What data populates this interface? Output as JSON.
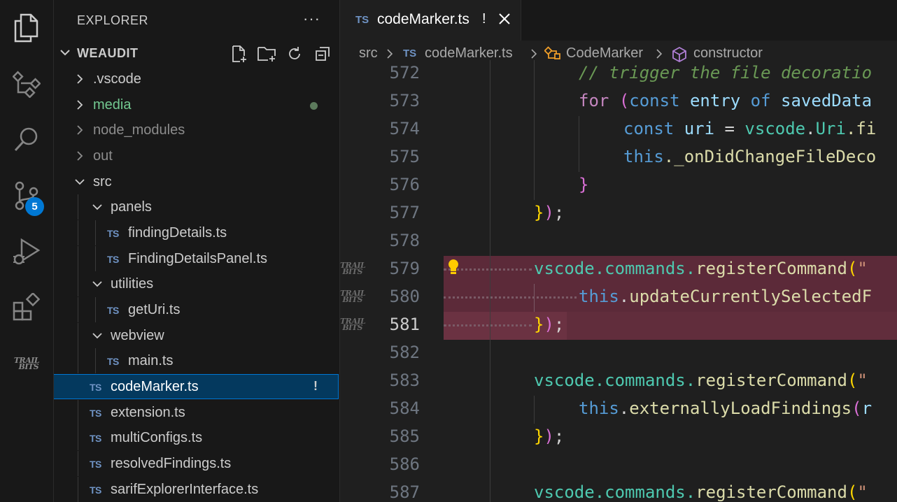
{
  "activity_bar": {
    "items": [
      "explorer-icon",
      "tree-icon",
      "search-icon",
      "source-control-icon",
      "run-debug-icon",
      "extensions-icon",
      "trailofbits-icon"
    ],
    "source_control_badge": "5",
    "trailofbits_logo_text": "TRAIL BITS"
  },
  "sidebar": {
    "title": "EXPLORER",
    "more": "···",
    "root": "WEAUDIT",
    "tree": [
      {
        "label": ".vscode",
        "type": "folder",
        "state": "collapsed"
      },
      {
        "label": "media",
        "type": "folder",
        "state": "collapsed",
        "status": "modified-dot"
      },
      {
        "label": "node_modules",
        "type": "folder",
        "state": "collapsed",
        "dim": true
      },
      {
        "label": "out",
        "type": "folder",
        "state": "collapsed",
        "dim": true
      },
      {
        "label": "src",
        "type": "folder",
        "state": "expanded"
      },
      {
        "label": "panels",
        "type": "folder",
        "state": "expanded"
      },
      {
        "label": "findingDetails.ts",
        "type": "file",
        "icon": "TS"
      },
      {
        "label": "FindingDetailsPanel.ts",
        "type": "file",
        "icon": "TS"
      },
      {
        "label": "utilities",
        "type": "folder",
        "state": "expanded"
      },
      {
        "label": "getUri.ts",
        "type": "file",
        "icon": "TS"
      },
      {
        "label": "webview",
        "type": "folder",
        "state": "expanded"
      },
      {
        "label": "main.ts",
        "type": "file",
        "icon": "TS"
      },
      {
        "label": "codeMarker.ts",
        "type": "file",
        "icon": "TS",
        "selected": true,
        "status": "!"
      },
      {
        "label": "extension.ts",
        "type": "file",
        "icon": "TS"
      },
      {
        "label": "multiConfigs.ts",
        "type": "file",
        "icon": "TS"
      },
      {
        "label": "resolvedFindings.ts",
        "type": "file",
        "icon": "TS"
      },
      {
        "label": "sarifExplorerInterface.ts",
        "type": "file",
        "icon": "TS"
      }
    ]
  },
  "editor": {
    "tab": {
      "icon": "TS",
      "name": "codeMarker.ts",
      "status": "!"
    },
    "breadcrumb": {
      "folder": "src",
      "file_icon": "TS",
      "file": "codeMarker.ts",
      "class": "CodeMarker",
      "member": "constructor"
    },
    "line_numbers": [
      "572",
      "573",
      "574",
      "575",
      "576",
      "577",
      "578",
      "579",
      "580",
      "581",
      "582",
      "583",
      "584",
      "585",
      "586",
      "587"
    ],
    "current_line": "581",
    "code": {
      "l572": "// trigger the file decoratio",
      "l573_for": "for",
      "l573_paren": "(",
      "l573_const": "const",
      "l573_entry": "entry",
      "l573_of": "of",
      "l573_saved": "savedData",
      "l574_const": "const",
      "l574_uri": "uri",
      "l574_eq": "=",
      "l574_vscode": "vscode",
      "l574_dot": ".",
      "l574_Uri": "Uri",
      "l574_rest": ".fi",
      "l575_this": "this",
      "l575_rest": "._onDidChangeFileDeco",
      "l576": "}",
      "l577_brace": "}",
      "l577_paren": ")",
      "l577_semi": ";",
      "l579_vscode": "vscode",
      "l579_commands": ".commands.",
      "l579_fn": "registerCommand",
      "l579_paren": "(",
      "l579_str": "\"",
      "l580_this": "this",
      "l580_dot": ".",
      "l580_fn": "updateCurrentlySelectedF",
      "l581_brace": "}",
      "l581_paren": ")",
      "l581_semi": ";",
      "l583_vscode": "vscode",
      "l583_commands": ".commands.",
      "l583_fn": "registerCommand",
      "l583_paren": "(",
      "l583_str": "\"",
      "l584_this": "this",
      "l584_dot": ".",
      "l584_fn": "externallyLoadFindings",
      "l584_paren": "(",
      "l584_rest": "r",
      "l585_brace": "}",
      "l585_paren": ")",
      "l585_semi": ";",
      "l587_vscode": "vscode",
      "l587_commands": ".commands.",
      "l587_fn": "registerCommand",
      "l587_paren": "(",
      "l587_str": "\""
    }
  },
  "colors": {
    "highlight": "#5c2a39",
    "accent": "#0078d4",
    "ts_icon": "#6f93c4"
  }
}
